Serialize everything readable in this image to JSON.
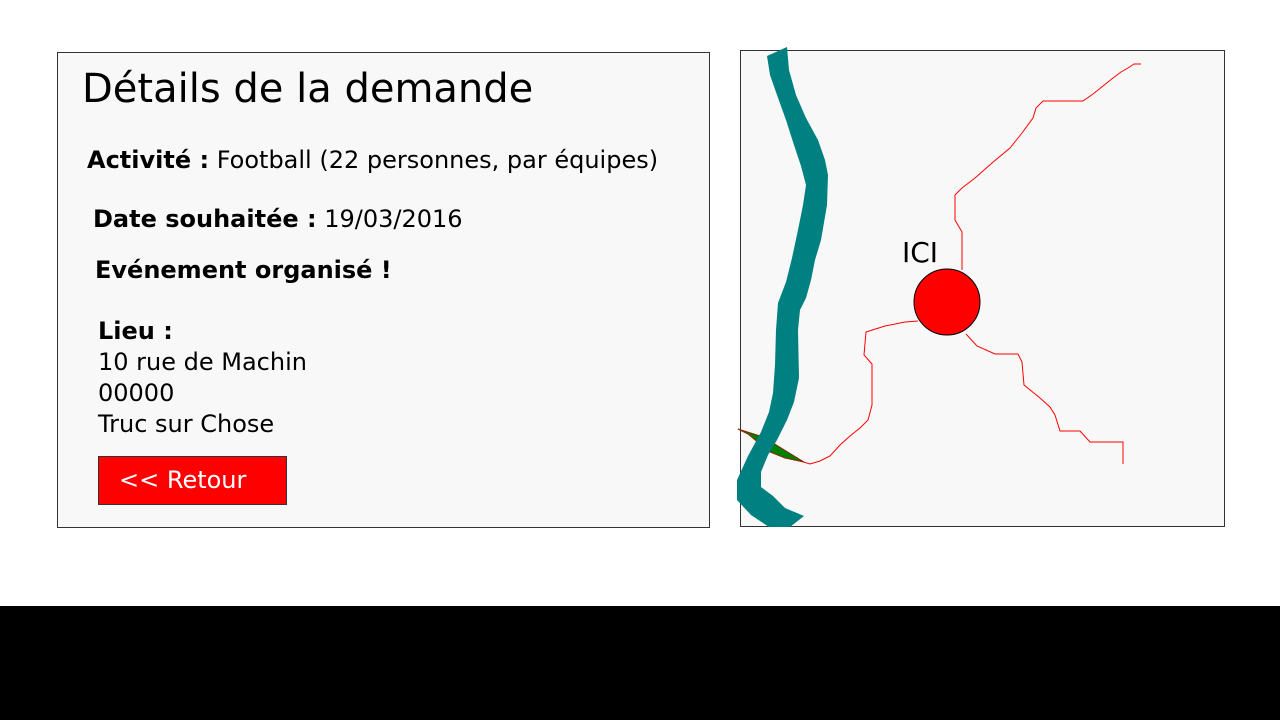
{
  "details": {
    "title": "Détails de la demande",
    "activity_label": "Activité :",
    "activity_value": "Football (22 personnes, par équipes)",
    "date_label": "Date souhaitée :",
    "date_value": "19/03/2016",
    "event_text": "Evénement organisé !",
    "lieu_label": "Lieu :",
    "address_line1": "10 rue de Machin",
    "address_line2": "00000",
    "address_line3": "Truc sur Chose",
    "back_button_label": "<< Retour"
  },
  "map": {
    "marker_label": "ICI",
    "colors": {
      "river": "#008080",
      "roads": "#ff0000",
      "marker": "#ff0000",
      "park": "#008000"
    },
    "icons": [
      "location-marker-icon",
      "river-shape",
      "road-lines"
    ]
  },
  "colors": {
    "panel_background": "#f8f8f8",
    "button_background": "#ff0000",
    "footer": "#000000"
  }
}
